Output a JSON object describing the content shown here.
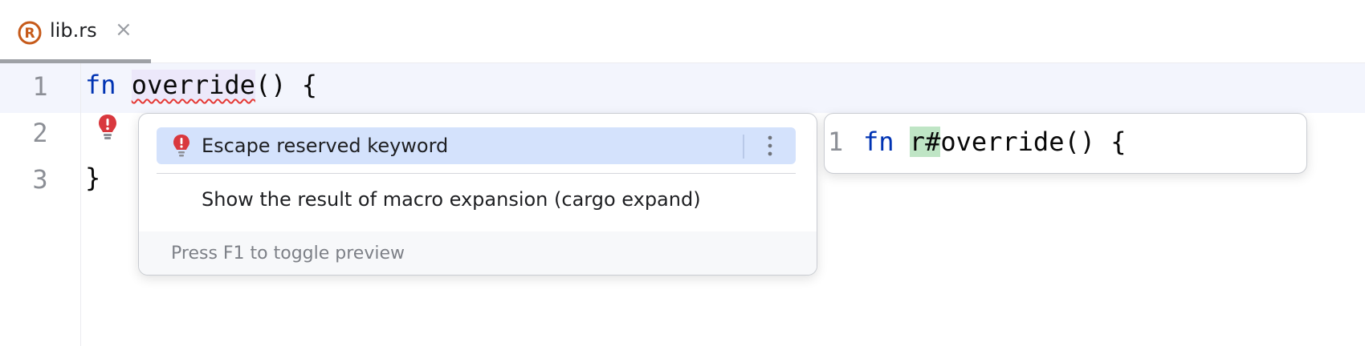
{
  "tab": {
    "label": "lib.rs",
    "icon": "rust-file-icon",
    "close_glyph": "×"
  },
  "editor": {
    "line_numbers": [
      "1",
      "2",
      "3"
    ],
    "lines": [
      {
        "keyword": "fn",
        "identifier": "override",
        "rest": "() {"
      },
      {
        "text": ""
      },
      {
        "text": "}"
      }
    ]
  },
  "intention_popup": {
    "items": [
      {
        "label": "Escape reserved keyword",
        "icon": "error-bulb-icon",
        "selected": true
      },
      {
        "label": "Show the result of macro expansion (cargo expand)",
        "selected": false
      }
    ],
    "footer": "Press F1 to toggle preview"
  },
  "preview": {
    "line_number": "1",
    "keyword": "fn",
    "added": "r#",
    "identifier": "override",
    "rest": "() {"
  },
  "colors": {
    "keyword": "#0033b3",
    "selection": "#d4e2fc",
    "added_highlight": "#bfe5c5",
    "error": "#e53935",
    "rust_icon": "#c65a1a"
  }
}
